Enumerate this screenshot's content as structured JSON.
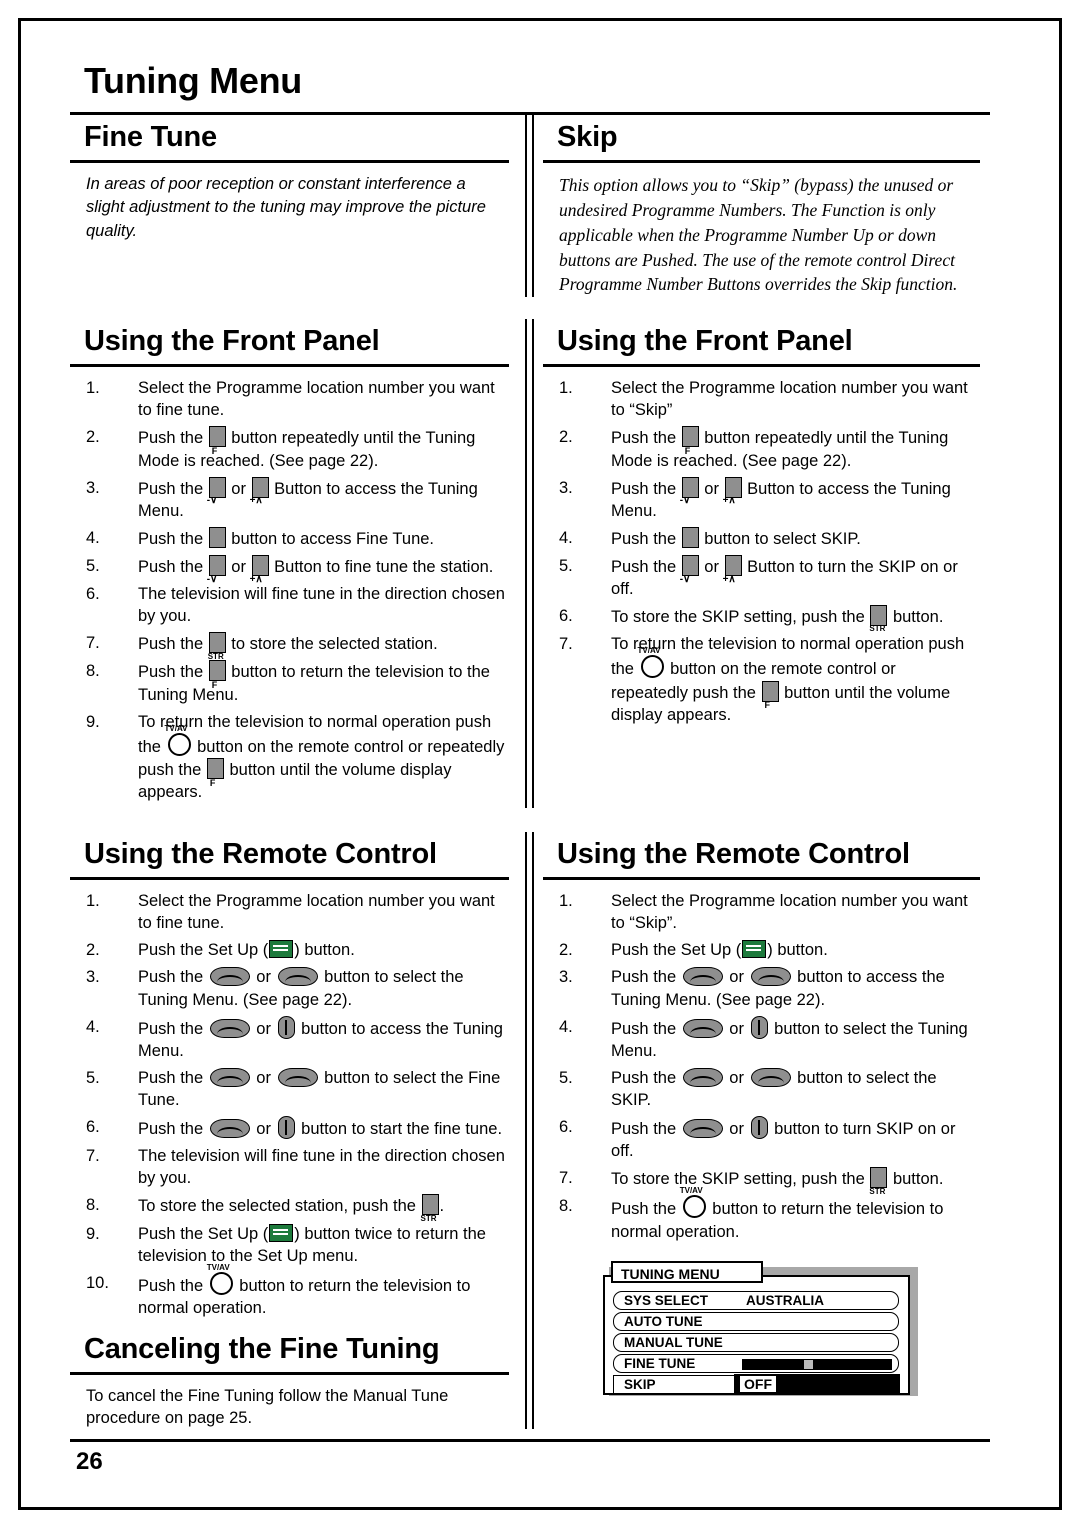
{
  "page": {
    "title": "Tuning Menu",
    "number": "26"
  },
  "left": {
    "heading": "Fine Tune",
    "intro": "In areas of poor reception or constant interference a slight adjustment to the tuning may improve the picture quality.",
    "front_panel": {
      "heading": "Using the Front Panel",
      "steps": [
        {
          "n": "1.",
          "pre": "Select the Programme location number you want to fine tune.",
          "post": ""
        },
        {
          "n": "2.",
          "pre": "Push the ",
          "btn": "f",
          "post": " button repeatedly until the Tuning Mode is reached. (See page 22)."
        },
        {
          "n": "3.",
          "pre": "Push the ",
          "btn": "minus-plus",
          "post": " Button to access the Tuning Menu."
        },
        {
          "n": "4.",
          "pre": "Push the ",
          "btn": "plain",
          "post": " button to access Fine Tune."
        },
        {
          "n": "5.",
          "pre": "Push the ",
          "btn": "minus-plus",
          "post": " Button to fine tune the station."
        },
        {
          "n": "6.",
          "pre": "The television will fine tune in the direction chosen by you.",
          "post": ""
        },
        {
          "n": "7.",
          "pre": "Push the ",
          "btn": "str",
          "post": " to store the selected station."
        },
        {
          "n": "8.",
          "pre": "Push the ",
          "btn": "f",
          "post": " button to return the television to the Tuning Menu."
        },
        {
          "n": "9.",
          "pre": "To return the television to normal operation push the ",
          "btn": "tvav-f",
          "post": " button on the remote control or repeatedly push the ",
          "post2": " button until the volume display appears."
        }
      ]
    },
    "remote": {
      "heading": "Using the Remote Control",
      "steps": [
        {
          "n": "1.",
          "pre": "Select the Programme location number you want to fine tune.",
          "post": ""
        },
        {
          "n": "2.",
          "pre": "Push the Set Up (",
          "btn": "setup",
          "post": ") button."
        },
        {
          "n": "3.",
          "pre": "Push the ",
          "btn": "rocker-rocker",
          "post": " button to select the Tuning Menu. (See page 22)."
        },
        {
          "n": "4.",
          "pre": "Push the ",
          "btn": "rocker-updown",
          "post": " button to access the Tuning Menu."
        },
        {
          "n": "5.",
          "pre": "Push the ",
          "btn": "rocker-rocker",
          "post": " button to select the Fine Tune."
        },
        {
          "n": "6.",
          "pre": "Push the ",
          "btn": "rocker-updown",
          "post": " button to start the fine tune."
        },
        {
          "n": "7.",
          "pre": "The television will fine tune in the direction chosen by you.",
          "post": ""
        },
        {
          "n": "8.",
          "pre": "To store the selected station, push the ",
          "btn": "str",
          "post": "."
        },
        {
          "n": "9.",
          "pre": "Push the Set Up (",
          "btn": "setup",
          "post": ") button twice to return the television to the Set Up menu."
        },
        {
          "n": "10.",
          "pre": "Push the ",
          "btn": "tvav",
          "post": " button to return the television to normal operation."
        }
      ]
    },
    "cancel": {
      "heading": "Canceling the Fine Tuning",
      "text": "To cancel the Fine Tuning follow the Manual Tune procedure on page 25."
    }
  },
  "right": {
    "heading": "Skip",
    "intro": "This option allows you to “Skip” (bypass) the unused or undesired Programme Numbers. The Function is only applicable when the Programme Number Up or down buttons are Pushed. The use of the remote control Direct Programme Number Buttons overrides the Skip function.",
    "front_panel": {
      "heading": "Using the Front Panel",
      "steps": [
        {
          "n": "1.",
          "pre": "Select the Programme location number you want to “Skip”",
          "post": ""
        },
        {
          "n": "2.",
          "pre": "Push the ",
          "btn": "f",
          "post": " button repeatedly until the Tuning Mode is reached. (See page 22)."
        },
        {
          "n": "3.",
          "pre": "Push the ",
          "btn": "minus-plus",
          "post": " Button to access the Tuning Menu."
        },
        {
          "n": "4.",
          "pre": "Push the ",
          "btn": "plain",
          "post": " button to select SKIP."
        },
        {
          "n": "5.",
          "pre": "Push the ",
          "btn": "minus-plus",
          "post": " Button to turn the SKIP on or off."
        },
        {
          "n": "6.",
          "pre": "To store the SKIP setting, push the ",
          "btn": "str",
          "post": " button."
        },
        {
          "n": "7.",
          "pre": "To return the television to normal operation push the ",
          "btn": "tvav-f",
          "post": " button on the remote control or repeatedly push the ",
          "post2": " button until the volume display appears."
        }
      ]
    },
    "remote": {
      "heading": "Using the Remote Control",
      "steps": [
        {
          "n": "1.",
          "pre": "Select the Programme location number you want to “Skip”.",
          "post": ""
        },
        {
          "n": "2.",
          "pre": "Push the Set Up (",
          "btn": "setup",
          "post": ") button."
        },
        {
          "n": "3.",
          "pre": "Push the ",
          "btn": "rocker-rocker",
          "post": " button to access the Tuning Menu. (See page 22)."
        },
        {
          "n": "4.",
          "pre": "Push the ",
          "btn": "rocker-updown",
          "post": " button to select the Tuning Menu."
        },
        {
          "n": "5.",
          "pre": "Push the ",
          "btn": "rocker-rocker",
          "post": " button to select the SKIP."
        },
        {
          "n": "6.",
          "pre": "Push the ",
          "btn": "rocker-updown",
          "post": " button to turn SKIP on or off."
        },
        {
          "n": "7.",
          "pre": "To store the SKIP setting, push the ",
          "btn": "str",
          "post": " button."
        },
        {
          "n": "8.",
          "pre": "Push the ",
          "btn": "tvav",
          "post": " button to return the television to normal operation."
        }
      ]
    },
    "osd": {
      "title": "TUNING MENU",
      "rows": [
        {
          "label": "SYS SELECT",
          "value": "AUSTRALIA"
        },
        {
          "label": "AUTO TUNE",
          "value": ""
        },
        {
          "label": "MANUAL TUNE",
          "value": ""
        },
        {
          "label": "FINE TUNE",
          "value": ""
        },
        {
          "label": "SKIP",
          "value": "OFF"
        }
      ]
    }
  }
}
